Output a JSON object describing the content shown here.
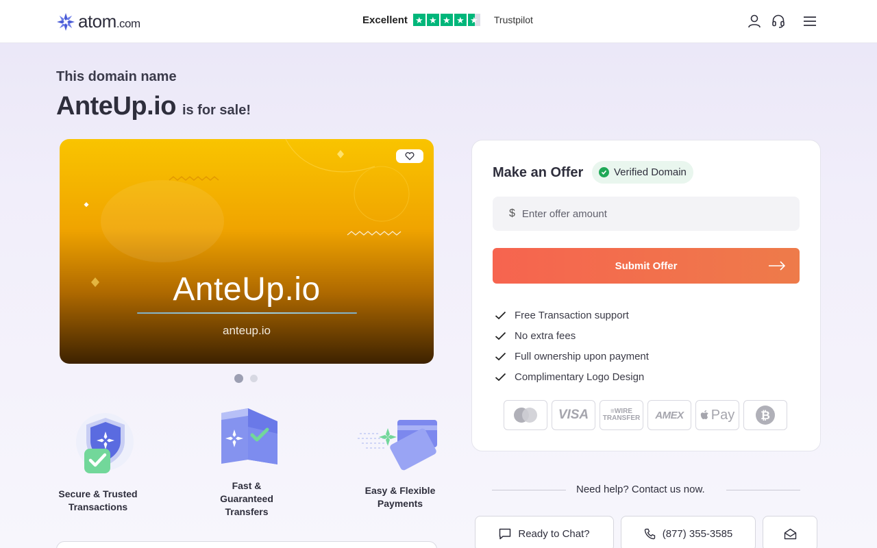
{
  "header": {
    "logo_text": "atom",
    "logo_suffix": ".com",
    "trust_label": "Excellent",
    "trust_name": "Trustpilot",
    "icons": [
      "user-icon",
      "headset-icon",
      "menu-icon"
    ]
  },
  "headline": {
    "kicker": "This domain name",
    "domain": "AnteUp.io",
    "suffix": "is for sale!"
  },
  "hero": {
    "title": "AnteUp.io",
    "subtitle": "anteup.io",
    "slides": 2,
    "active_slide": 1
  },
  "features": [
    {
      "label_1": "Secure & Trusted",
      "label_2": "Transactions"
    },
    {
      "label_1": "Fast &",
      "label_2": "Guaranteed",
      "label_3": "Transfers"
    },
    {
      "label_1": "Easy & Flexible",
      "label_2": "Payments"
    }
  ],
  "offer": {
    "title": "Make an Offer",
    "badge": "Verified Domain",
    "currency": "$",
    "placeholder": "Enter offer amount",
    "submit": "Submit Offer",
    "benefits": [
      "Free Transaction support",
      "No extra fees",
      "Full ownership upon payment",
      "Complimentary Logo Design"
    ],
    "payment_methods": [
      "mastercard",
      "VISA",
      "WIRE TRANSFER",
      "AMEX",
      "Pay",
      "bitcoin"
    ]
  },
  "help": {
    "text": "Need help? Contact us now.",
    "chat": "Ready to Chat?",
    "phone": "(877) 355-3585"
  },
  "colors": {
    "accent": "#f6644f",
    "trustpilot": "#00b67a",
    "verified": "#20a857"
  }
}
